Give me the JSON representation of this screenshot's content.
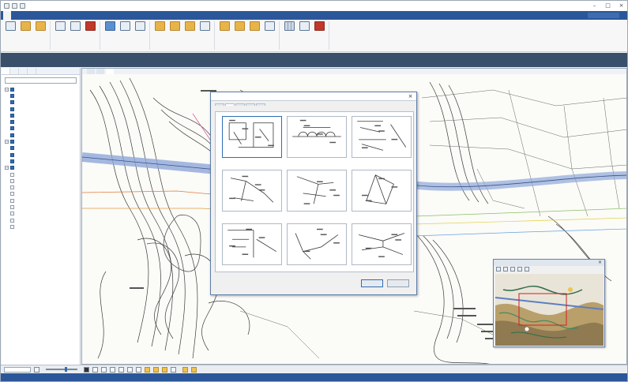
{
  "colors": {
    "ribbon_tab_bar": "#2b579a",
    "command_bar": "#3a4f6a",
    "status_bar": "#2b579a",
    "contour_line": "#333333",
    "road_band": "#8fa8d8",
    "selection_accent": "#2f6db5"
  },
  "titlebar": {
    "title": "",
    "quick_access_icons": [
      "save-icon",
      "undo-icon",
      "redo-icon"
    ],
    "controls": {
      "minimize": "–",
      "maximize": "□",
      "close": "×"
    }
  },
  "ribbon": {
    "tabs": [
      {
        "label": "",
        "active": true
      },
      {
        "label": "",
        "active": false
      },
      {
        "label": "",
        "active": false
      },
      {
        "label": "",
        "active": false
      },
      {
        "label": "",
        "active": false
      },
      {
        "label": "",
        "active": false
      },
      {
        "label": "",
        "active": false
      },
      {
        "label": "",
        "active": false
      },
      {
        "label": "",
        "active": false
      },
      {
        "label": "",
        "active": false
      },
      {
        "label": "",
        "active": false
      },
      {
        "label": "",
        "active": false
      },
      {
        "label": "",
        "active": false
      },
      {
        "label": "",
        "active": false
      },
      {
        "label": "",
        "active": false
      },
      {
        "label": "",
        "active": false
      },
      {
        "label": "",
        "active": false
      },
      {
        "label": "",
        "active": false
      }
    ],
    "groups": [
      {
        "label": "",
        "buttons": [
          {
            "label": "",
            "icon": "new-file-icon"
          },
          {
            "label": "",
            "icon": "open-folder-icon"
          },
          {
            "label": "",
            "icon": "open-recent-icon"
          }
        ]
      },
      {
        "label": "",
        "buttons": [
          {
            "label": "",
            "icon": "save-icon"
          },
          {
            "label": "",
            "icon": "save-as-icon"
          },
          {
            "label": "",
            "icon": "pdf-icon"
          }
        ]
      },
      {
        "label": "",
        "buttons": [
          {
            "label": "",
            "icon": "print-icon"
          },
          {
            "label": "",
            "icon": "print-preview-icon"
          },
          {
            "label": "",
            "icon": "print-settings-icon"
          }
        ]
      },
      {
        "label": "",
        "buttons": [
          {
            "label": "",
            "icon": "import-icon"
          },
          {
            "label": "",
            "icon": "import-folder-icon"
          },
          {
            "label": "",
            "icon": "import-folder-icon"
          },
          {
            "label": "",
            "icon": "import-document-icon"
          }
        ]
      },
      {
        "label": "",
        "buttons": [
          {
            "label": "",
            "icon": "export-icon"
          },
          {
            "label": "",
            "icon": "export-folder-icon"
          },
          {
            "label": "",
            "icon": "export-folder-icon"
          },
          {
            "label": "",
            "icon": "export-document-icon"
          }
        ]
      },
      {
        "label": "",
        "buttons": [
          {
            "label": "",
            "icon": "table-icon"
          },
          {
            "label": "",
            "icon": "report-icon"
          },
          {
            "label": "",
            "icon": "report-pdf-icon"
          }
        ]
      }
    ]
  },
  "command_bar_1": {
    "items": [
      "",
      "",
      "",
      "",
      "",
      "",
      "",
      "",
      "",
      "",
      "",
      "",
      "",
      "",
      "",
      ""
    ],
    "right_text": ""
  },
  "command_bar_2": {
    "items": [
      "",
      "",
      "",
      "",
      "",
      "",
      "",
      "",
      "",
      "",
      ""
    ]
  },
  "left_panel": {
    "tabs": [
      "",
      "",
      "",
      ""
    ],
    "combo_value": "",
    "tree": [
      {
        "label": "",
        "level": 0,
        "expanded": true,
        "checked": true
      },
      {
        "label": "",
        "level": 1,
        "expanded": false,
        "checked": true
      },
      {
        "label": "",
        "level": 1,
        "expanded": false,
        "checked": true
      },
      {
        "label": "",
        "level": 1,
        "expanded": false,
        "checked": true
      },
      {
        "label": "",
        "level": 1,
        "expanded": false,
        "checked": true
      },
      {
        "label": "",
        "level": 1,
        "expanded": false,
        "checked": true
      },
      {
        "label": "",
        "level": 1,
        "expanded": false,
        "checked": true
      },
      {
        "label": "",
        "level": 1,
        "expanded": false,
        "checked": true
      },
      {
        "label": "",
        "level": 0,
        "expanded": true,
        "checked": true
      },
      {
        "label": "",
        "level": 1,
        "expanded": false,
        "checked": true
      },
      {
        "label": "",
        "level": 1,
        "expanded": false,
        "checked": true
      },
      {
        "label": "",
        "level": 1,
        "expanded": false,
        "checked": true
      },
      {
        "label": "",
        "level": 0,
        "expanded": true,
        "checked": true
      },
      {
        "label": "",
        "level": 1,
        "expanded": false,
        "checked": false
      },
      {
        "label": "",
        "level": 1,
        "expanded": false,
        "checked": false
      },
      {
        "label": "",
        "level": 1,
        "expanded": false,
        "checked": false
      },
      {
        "label": "",
        "level": 1,
        "expanded": false,
        "checked": false
      },
      {
        "label": "",
        "level": 1,
        "expanded": false,
        "checked": false
      },
      {
        "label": "",
        "level": 1,
        "expanded": false,
        "checked": false
      },
      {
        "label": "",
        "level": 1,
        "expanded": false,
        "checked": false
      },
      {
        "label": "",
        "level": 1,
        "expanded": false,
        "checked": false
      },
      {
        "label": "",
        "level": 1,
        "expanded": false,
        "checked": false
      }
    ]
  },
  "map": {
    "tabs": [
      {
        "label": "",
        "active": false
      },
      {
        "label": "",
        "active": false
      },
      {
        "label": "",
        "active": true
      }
    ]
  },
  "dialog": {
    "title": "",
    "close_label": "×",
    "tabs": [
      {
        "label": "",
        "active": false
      },
      {
        "label": "",
        "active": true
      },
      {
        "label": "",
        "active": false
      },
      {
        "label": "",
        "active": false
      },
      {
        "label": "",
        "active": false
      }
    ],
    "templates": [
      {
        "caption": "",
        "selected": true
      },
      {
        "caption": "",
        "selected": false
      },
      {
        "caption": "",
        "selected": false
      },
      {
        "caption": "",
        "selected": false
      },
      {
        "caption": "",
        "selected": false
      },
      {
        "caption": "",
        "selected": false
      },
      {
        "caption": "",
        "selected": false
      },
      {
        "caption": "",
        "selected": false
      },
      {
        "caption": "",
        "selected": false
      }
    ],
    "ok_label": "",
    "cancel_label": ""
  },
  "overview": {
    "title": "",
    "close_label": "×"
  },
  "bottom_toolbar": {
    "scale_value": "",
    "zoom_label": "",
    "coordinate_text": "",
    "mode_label": ""
  },
  "status_bar": {
    "items": [
      "",
      "",
      "",
      "",
      "",
      ""
    ]
  }
}
